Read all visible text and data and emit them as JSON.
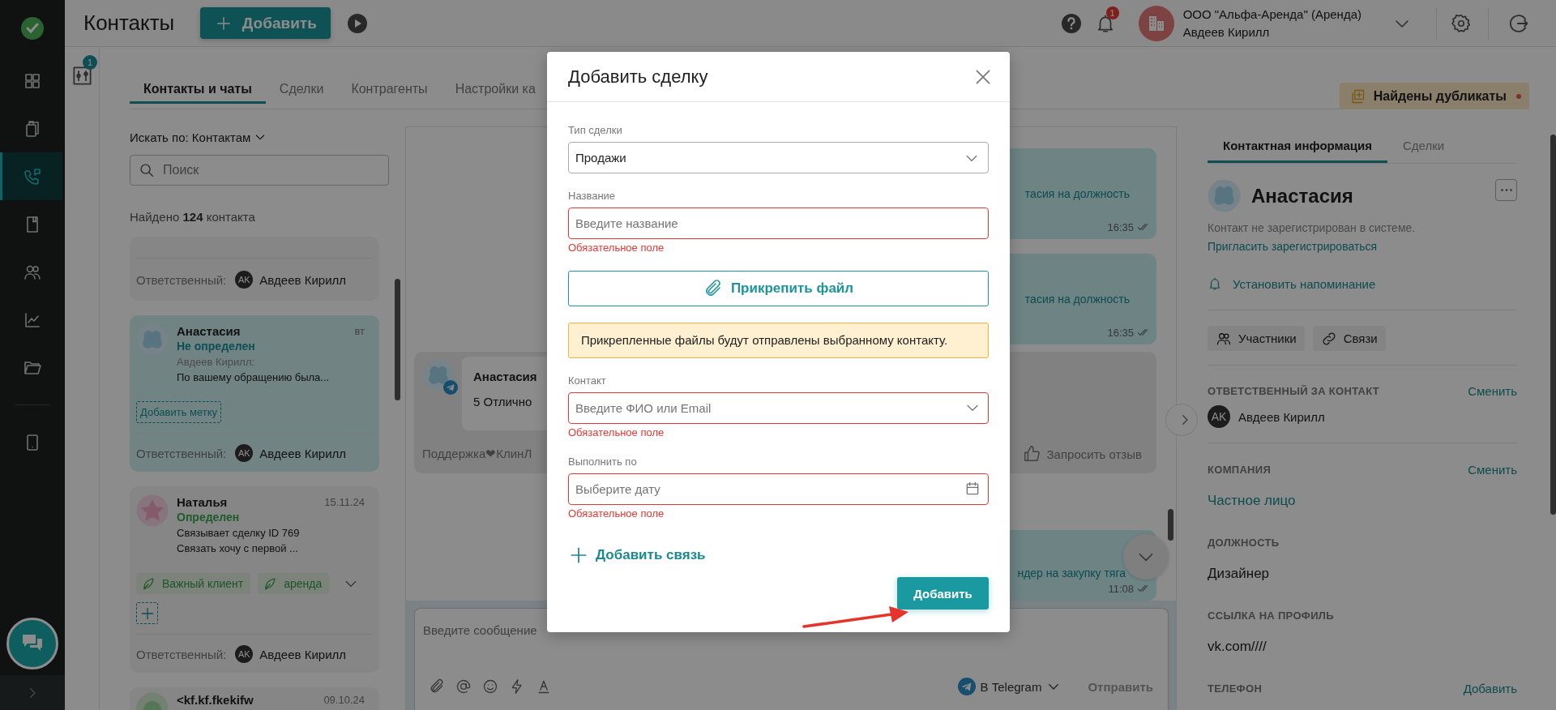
{
  "sidebar": {
    "items": [
      {
        "selected": false
      },
      {
        "selected": false
      },
      {
        "selected": true
      },
      {
        "selected": false
      },
      {
        "selected": false
      },
      {
        "selected": false
      },
      {
        "selected": false
      },
      {
        "selected": false
      }
    ]
  },
  "header": {
    "title": "Контакты",
    "add_button": "Добавить",
    "notification_count": "1",
    "account": {
      "organization": "ООО \"Альфа-Аренда\" (Аренда)",
      "user": "Авдеев Кирилл"
    }
  },
  "filter_badge": "1",
  "tabs": [
    {
      "label": "Контакты и чаты",
      "selected": true
    },
    {
      "label": "Сделки",
      "selected": false
    },
    {
      "label": "Контрагенты",
      "selected": false
    },
    {
      "label": "Настройки ка",
      "selected": false
    }
  ],
  "duplicates_button": "Найдены дубликаты",
  "contacts": {
    "search_by": "Искать по: Контактам",
    "search_placeholder": "Поиск",
    "found": "Найдено **124** контакта",
    "cards": [
      {
        "selected": false,
        "responsible_label": "Ответственный:",
        "responsible_initials": "AK",
        "responsible_name": "Авдеев Кирилл"
      },
      {
        "selected": true,
        "name": "Анастасия",
        "time": "вт",
        "status": {
          "text": "Не определен",
          "kind": "unidentified"
        },
        "author": "Авдеев Кирилл:",
        "preview": [
          "По вашему обращению была..."
        ],
        "add_tag": "Добавить метку",
        "responsible_label": "Ответственный:",
        "responsible_initials": "AK",
        "responsible_name": "Авдеев Кирилл"
      },
      {
        "selected": false,
        "name": "Наталья",
        "time": "15.11.24",
        "status": {
          "text": "Определен",
          "kind": "identified"
        },
        "preview": [
          "Связывает сделку ID 769",
          "Связать хочу с первой ..."
        ],
        "tags": [
          {
            "label": "Важный клиент"
          },
          {
            "label": "аренда"
          }
        ],
        "responsible_label": "Ответственный:",
        "responsible_initials": "AK",
        "responsible_name": "Авдеев Кирилл"
      },
      {
        "selected": false,
        "name": "<kf.kf.fkekifw",
        "time": "09.10.24"
      }
    ]
  },
  "chat": {
    "messages": [
      {
        "kind": "bubble",
        "text": "тасия на должность",
        "time": "16:35"
      },
      {
        "kind": "bubble",
        "text": "тасия на должность",
        "time": "16:35"
      },
      {
        "kind": "rating",
        "name": "Анастасия",
        "text": "5 Отлично",
        "footer": "Поддержка❤КлинЛ",
        "action": "Запросить отзыв"
      },
      {
        "kind": "bubble",
        "text": "ндер на закупку тяга",
        "time": "11:08"
      }
    ],
    "input_placeholder": "Введите сообщение",
    "channel": "В Telegram",
    "send": "Отправить"
  },
  "info": {
    "tabs": [
      {
        "label": "Контактная информация",
        "selected": true
      },
      {
        "label": "Сделки",
        "selected": false
      }
    ],
    "name": "Анастасия",
    "note": "Контакт не зарегистрирован в системе.",
    "invite_link": "Пригласить зарегистрироваться",
    "reminder": "Установить напоминание",
    "buttons": [
      "Участники",
      "Связи"
    ],
    "sections": [
      {
        "title": "ОТВЕТСТВЕННЫЙ ЗА КОНТАКТ",
        "action": "Сменить",
        "kind": "person",
        "initials": "AK",
        "value": "Авдеев Кирилл"
      },
      {
        "title": "КОМПАНИЯ",
        "action": "Сменить",
        "kind": "link",
        "value": "Частное лицо"
      },
      {
        "title": "ДОЛЖНОСТЬ",
        "kind": "text",
        "value": "Дизайнер"
      },
      {
        "title": "ССЫЛКА НА ПРОФИЛЬ",
        "kind": "text",
        "value": "vk.com////"
      },
      {
        "title": "ТЕЛЕФОН",
        "action": "Добавить",
        "kind": "empty"
      }
    ]
  },
  "modal": {
    "title": "Добавить сделку",
    "items": [
      {
        "kind": "select",
        "label": "Тип сделки",
        "value": "Продажи",
        "invalid": false
      },
      {
        "kind": "input",
        "label": "Название",
        "placeholder": "Введите название",
        "invalid": true,
        "error": "Обязательное поле"
      },
      {
        "kind": "attach",
        "label": "Прикрепить файл"
      },
      {
        "kind": "notice",
        "text": "Прикрепленные файлы будут отправлены выбранному контакту."
      },
      {
        "kind": "combo",
        "label": "Контакт",
        "placeholder": "Введите ФИО или Email",
        "invalid": true,
        "error": "Обязательное поле"
      },
      {
        "kind": "date",
        "label": "Выполнить по",
        "placeholder": "Выберите дату",
        "invalid": true,
        "error": "Обязательное поле"
      },
      {
        "kind": "add_link",
        "label": "Добавить связь"
      }
    ],
    "submit": "Добавить"
  }
}
